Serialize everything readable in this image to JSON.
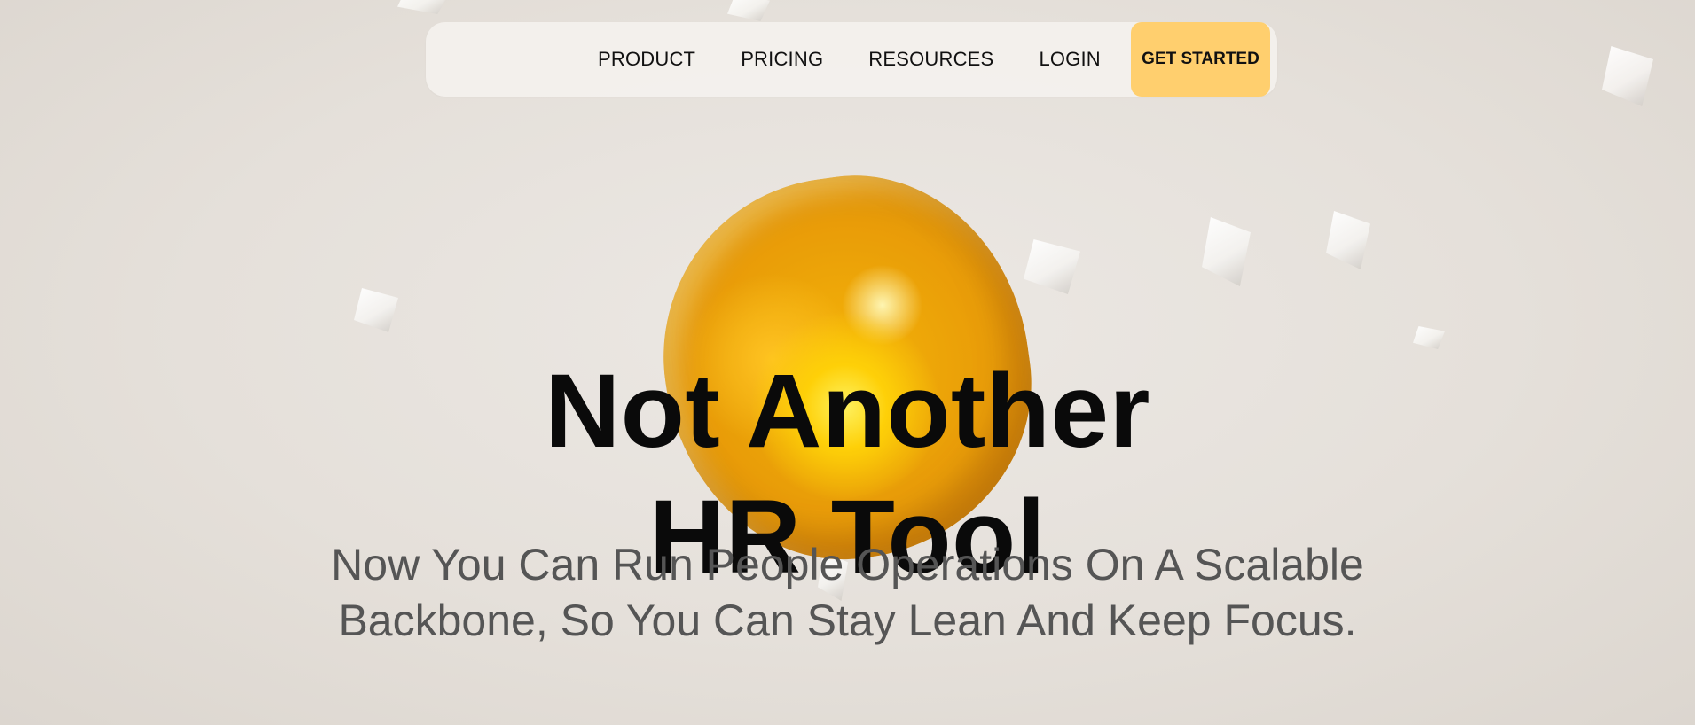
{
  "nav": {
    "links": [
      "PRODUCT",
      "PRICING",
      "RESOURCES",
      "LOGIN"
    ],
    "cta_label": "GET STARTED"
  },
  "hero": {
    "title_line1": "Not Another",
    "title_line2": "HR Tool",
    "subtitle_line1": "Now You Can Run People Operations On A Scalable",
    "subtitle_line2": "Backbone, So You Can Stay Lean And Keep Focus."
  },
  "colors": {
    "cta_background": "#ffcf6e",
    "blob": "#f2a900",
    "title": "#0a0a0a",
    "subtitle": "#555555"
  }
}
